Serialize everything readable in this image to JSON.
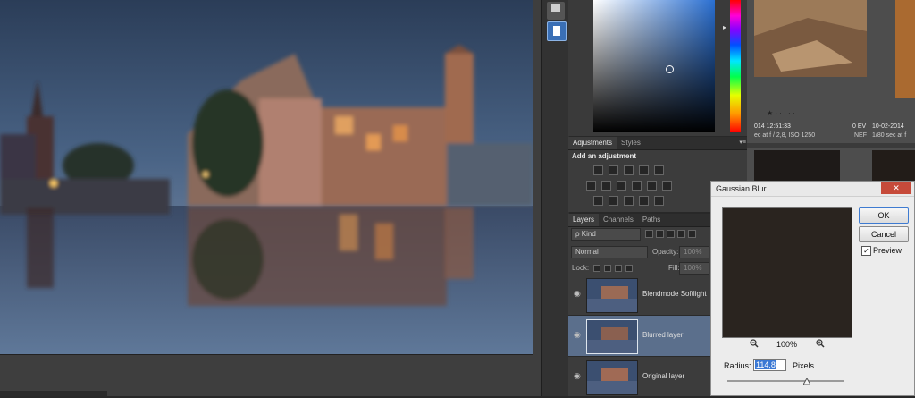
{
  "color_panel": {
    "hue_marker": "▸"
  },
  "adjustments_panel": {
    "tabs": [
      "Adjustments",
      "Styles"
    ],
    "heading": "Add an adjustment",
    "menu_glyph": "▾≡"
  },
  "layers_panel": {
    "tabs": [
      "Layers",
      "Channels",
      "Paths"
    ],
    "filter_kind": "ρ Kind",
    "blend_mode": "Normal",
    "opacity_label": "Opacity:",
    "opacity_value": "100%",
    "lock_label": "Lock:",
    "fill_label": "Fill:",
    "fill_value": "100%",
    "layers": [
      {
        "name": "Blendmode Softlight",
        "selected": false
      },
      {
        "name": "Blurred layer",
        "selected": true
      },
      {
        "name": "Original layer",
        "selected": false
      }
    ]
  },
  "bridge": {
    "rating": "★ · · · · ·",
    "meta_date_1": "014 12:51:33",
    "meta_exp_1": "ec at f / 2,8, ISO 1250",
    "meta_ev": "0 EV",
    "meta_nef": "NEF",
    "meta_date_2": "10-02-2014",
    "meta_exp_2": "1/80 sec at f"
  },
  "dialog": {
    "title": "Gaussian Blur",
    "ok_label": "OK",
    "cancel_label": "Cancel",
    "preview_label": "Preview",
    "preview_checked": "✓",
    "zoom_level": "100%",
    "radius_label": "Radius:",
    "radius_value": "114,8",
    "radius_unit": "Pixels",
    "close_glyph": "✕"
  }
}
